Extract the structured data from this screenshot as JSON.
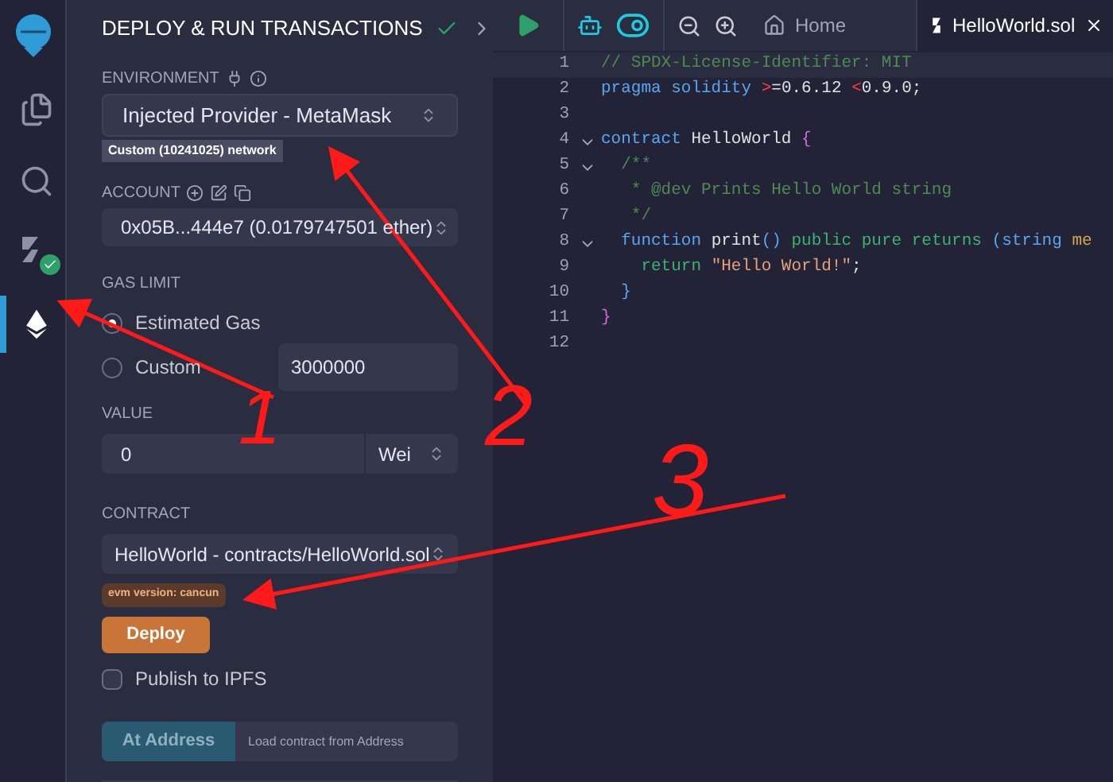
{
  "icon_bar": [
    {
      "kind": "files",
      "selected": false
    },
    {
      "kind": "search",
      "selected": false
    },
    {
      "kind": "compiler",
      "selected": false
    },
    {
      "kind": "deploy",
      "selected": true
    }
  ],
  "panel": {
    "title": "DEPLOY & RUN TRANSACTIONS",
    "environment": {
      "label": "ENVIRONMENT",
      "value": "Injected Provider - MetaMask",
      "network": "Custom (10241025) network"
    },
    "account": {
      "label": "ACCOUNT",
      "value": "0x05B...444e7 (0.0179747501 ether)"
    },
    "gas_limit": {
      "label": "GAS LIMIT",
      "options": [
        {
          "label": "Estimated Gas",
          "selected": true
        },
        {
          "label": "Custom",
          "selected": false
        }
      ],
      "custom_value": "3000000"
    },
    "value": {
      "label": "VALUE",
      "amount": "0",
      "unit": "Wei"
    },
    "contract": {
      "label": "CONTRACT",
      "value": "HelloWorld - contracts/HelloWorld.sol",
      "evm_badge": "evm version: cancun"
    },
    "deploy_button": "Deploy",
    "publish_ipfs": {
      "label": "Publish to IPFS",
      "checked": false
    },
    "at_address": {
      "button": "At Address",
      "placeholder": "Load contract from Address"
    }
  },
  "editor": {
    "tabs": [
      {
        "label": "Home",
        "selected": false
      },
      {
        "label": "HelloWorld.sol",
        "selected": true
      }
    ],
    "lines": [
      {
        "number": "1",
        "fold": false,
        "tokens": [
          {
            "kind": "comment",
            "text": "// SPDX-License-Identifier: MIT"
          }
        ]
      },
      {
        "number": "2",
        "fold": false,
        "tokens": [
          {
            "kind": "keyword",
            "text": "pragma solidity "
          },
          {
            "kind": "operator",
            "text": ">"
          },
          {
            "kind": "plain",
            "text": "=0.6.12 "
          },
          {
            "kind": "operator",
            "text": "<"
          },
          {
            "kind": "plain",
            "text": "0.9.0;"
          }
        ]
      },
      {
        "number": "3",
        "fold": false
      },
      {
        "number": "4",
        "fold": true,
        "tokens": [
          {
            "kind": "keyword",
            "text": "contract "
          },
          {
            "kind": "plain",
            "text": "HelloWorld "
          },
          {
            "kind": "brace",
            "text": "{"
          }
        ]
      },
      {
        "number": "5",
        "fold": true,
        "tokens": [
          {
            "kind": "comment",
            "text": "  /**"
          }
        ]
      },
      {
        "number": "6",
        "fold": false,
        "tokens": [
          {
            "kind": "comment",
            "text": "   * @dev Prints Hello World string"
          }
        ]
      },
      {
        "number": "7",
        "fold": false,
        "tokens": [
          {
            "kind": "comment",
            "text": "   */"
          }
        ]
      },
      {
        "number": "8",
        "fold": true,
        "tokens": [
          {
            "kind": "keyword",
            "text": "  function "
          },
          {
            "kind": "plain",
            "text": "print"
          },
          {
            "kind": "keyword",
            "text": "() "
          },
          {
            "kind": "modifier",
            "text": "public pure returns "
          },
          {
            "kind": "keyword",
            "text": "(string "
          },
          {
            "kind": "name",
            "text": "me"
          }
        ]
      },
      {
        "number": "9",
        "fold": false,
        "tokens": [
          {
            "kind": "modifier",
            "text": "    return "
          },
          {
            "kind": "string",
            "text": "\"Hello World!\""
          },
          {
            "kind": "plain",
            "text": ";"
          }
        ]
      },
      {
        "number": "10",
        "fold": false,
        "tokens": [
          {
            "kind": "keyword",
            "text": "  }"
          }
        ]
      },
      {
        "number": "11",
        "fold": false,
        "tokens": [
          {
            "kind": "brace",
            "text": "}"
          }
        ]
      },
      {
        "number": "12",
        "fold": false
      }
    ]
  },
  "annotations": [
    {
      "label": "1"
    },
    {
      "label": "2"
    },
    {
      "label": "3"
    }
  ]
}
